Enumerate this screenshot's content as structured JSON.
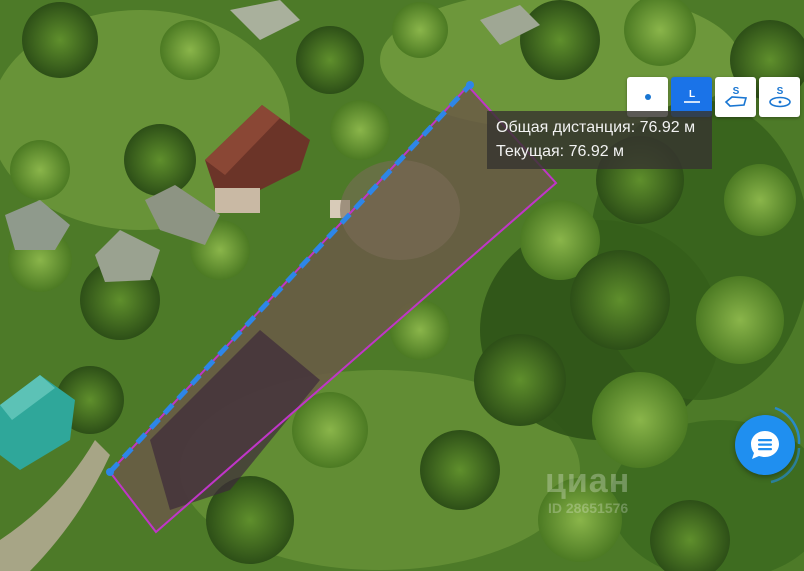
{
  "toolbar": {
    "buttons": [
      {
        "name": "point-tool",
        "label": "",
        "active": false
      },
      {
        "name": "line-tool",
        "label": "L",
        "active": true
      },
      {
        "name": "area-tool",
        "label": "S",
        "active": false
      },
      {
        "name": "circle-area-tool",
        "label": "S",
        "active": false
      }
    ]
  },
  "measurement": {
    "total_label": "Общая дистанция: 76.92 м",
    "current_label": "Текущая: 76.92 м"
  },
  "watermark": {
    "brand": "циан",
    "id_text": "ID 28651576"
  },
  "colors": {
    "parcel_outline": "#c035c8",
    "measure_line": "#2d86e8",
    "accent": "#1a73e8"
  },
  "icons": {
    "chat": "chat-bubble-icon"
  }
}
